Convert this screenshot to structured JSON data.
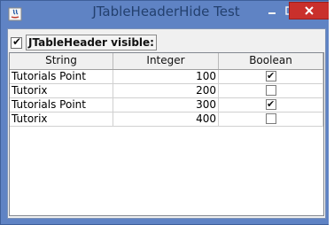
{
  "window": {
    "title": "JTableHeaderHide Test",
    "controls": {
      "minimize_icon": "minimize-icon",
      "maximize_icon": "maximize-icon",
      "close_icon": "close-icon"
    },
    "colors": {
      "frame": "#5f83c4",
      "close": "#c9302c",
      "client": "#f0f0f0"
    }
  },
  "options": {
    "header_visible_label": "JTableHeader visible:",
    "header_visible_checked": true
  },
  "table": {
    "columns": [
      "String",
      "Integer",
      "Boolean"
    ],
    "rows": [
      {
        "string": "Tutorials Point",
        "integer": "100",
        "boolean": true
      },
      {
        "string": "Tutorix",
        "integer": "200",
        "boolean": false
      },
      {
        "string": "Tutorials Point",
        "integer": "300",
        "boolean": true
      },
      {
        "string": "Tutorix",
        "integer": "400",
        "boolean": false
      }
    ]
  }
}
